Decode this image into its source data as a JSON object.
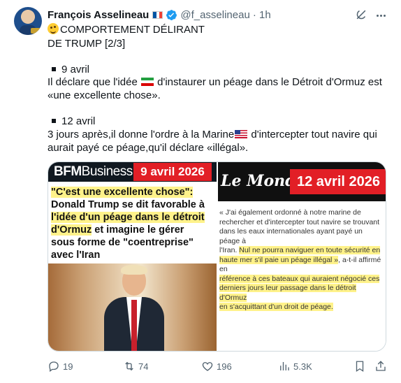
{
  "author": {
    "name": "François Asselineau",
    "handle": "@f_asselineau",
    "time": "· 1h"
  },
  "tweet": {
    "line1": "COMPORTEMENT DÉLIRANT",
    "line2": "DE TRUMP [2/3]",
    "date1": "9 avril",
    "para1_a": "Il déclare que l'idée",
    "para1_b": "d'instaurer un péage dans le Détroit d'Ormuz est",
    "para1_c": "«une excellente chose».",
    "date2": "12 avril",
    "para2_a": "3 jours après,il donne l'ordre à la Marine",
    "para2_b": "d'intercepter tout navire qui",
    "para2_c": "aurait payé ce péage,qu'il déclare «illégal»."
  },
  "media": {
    "bfm": {
      "logo_bold": "BFM",
      "logo_rest": "Business",
      "date": "9 avril 2026",
      "quote": "\"C'est une excellente chose\":",
      "headline_1": "Donald Trump se dit favorable à",
      "headline_2": "l'idée d'un péage dans le détroit",
      "headline_3": "d'Ormuz",
      "headline_4": " et imagine le gérer",
      "headline_5": "sous forme de \"coentreprise\"",
      "headline_6": "avec l'Iran"
    },
    "monde": {
      "logo": "Le Monde",
      "date": "12 avril 2026",
      "l1": "« J'ai également ordonné à notre marine de",
      "l2": "rechercher et d'intercepter tout navire se trouvant",
      "l3": "dans les eaux internationales ayant payé un péage à",
      "l4": "l'Iran. ",
      "l4_hl": "Nul ne pourra naviguer en toute sécurité en",
      "l5_hl": "haute mer s'il paie un péage illégal »",
      "l5": ", a-t-il affirmé en",
      "l6_hl": "référence à ces bateaux qui auraient négocié ces",
      "l7_hl": "derniers jours leur passage dans le détroit d'Ormuz",
      "l8_hl": "en s'acquittant d'un droit de péage."
    }
  },
  "actions": {
    "replies": "19",
    "reposts": "74",
    "likes": "196",
    "views": "5.3K"
  },
  "colors": {
    "text": "#0f1419",
    "secondary": "#536471",
    "verified": "#1d9bf0",
    "highlight": "#fff28a",
    "red": "#e21f26"
  }
}
